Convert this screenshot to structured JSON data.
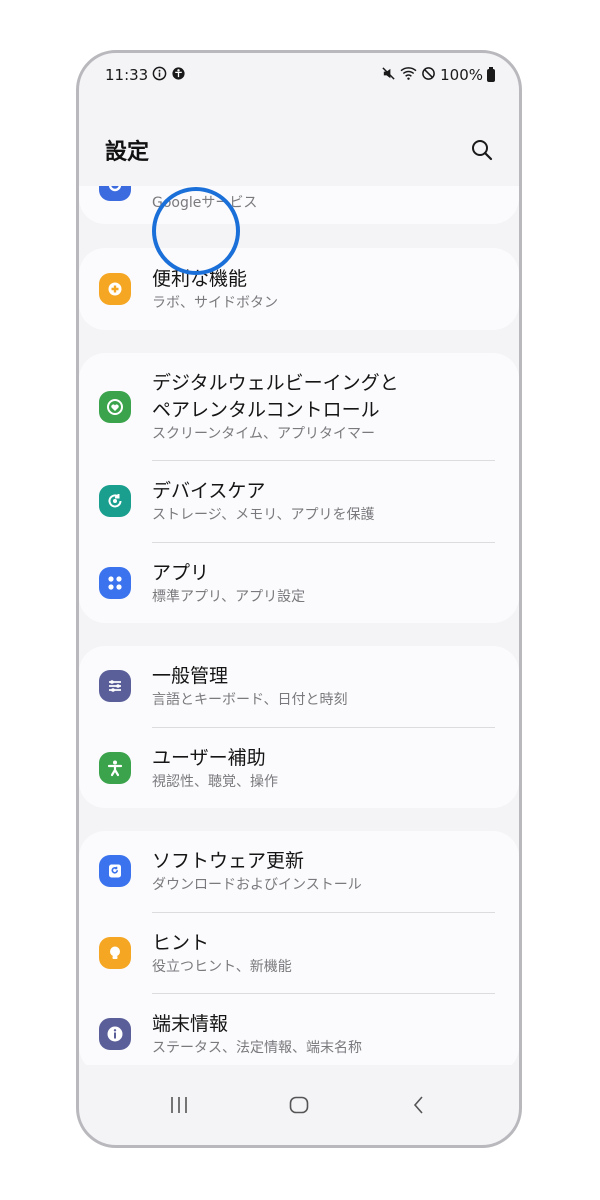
{
  "status_bar": {
    "time": "11:33",
    "left_icons": [
      "info-icon",
      "accessibility-icon"
    ],
    "right_icons": [
      "mute-icon",
      "wifi-icon",
      "dnd-icon"
    ],
    "battery": "100%"
  },
  "header": {
    "title": "設定",
    "search_icon": "search-icon"
  },
  "sections": [
    {
      "items": [
        {
          "title": "",
          "subtitle": "Googleサービス",
          "icon": "google-icon",
          "color": "#3c6be0"
        }
      ]
    },
    {
      "items": [
        {
          "title": "便利な機能",
          "subtitle": "ラボ、サイドボタン",
          "icon": "plus-gear-icon",
          "color": "#f5a623"
        }
      ]
    },
    {
      "items": [
        {
          "title": "デジタルウェルビーイングと",
          "title2": "ペアレンタルコントロール",
          "subtitle": "スクリーンタイム、アプリタイマー",
          "icon": "heart-circle-icon",
          "color": "#3aa34b"
        },
        {
          "title": "デバイスケア",
          "subtitle": "ストレージ、メモリ、アプリを保護",
          "icon": "refresh-icon",
          "color": "#1a9e8e"
        },
        {
          "title": "アプリ",
          "subtitle": "標準アプリ、アプリ設定",
          "icon": "apps-grid-icon",
          "color": "#3b73ee"
        }
      ]
    },
    {
      "items": [
        {
          "title": "一般管理",
          "subtitle": "言語とキーボード、日付と時刻",
          "icon": "sliders-icon",
          "color": "#5b5f99"
        },
        {
          "title": "ユーザー補助",
          "subtitle": "視認性、聴覚、操作",
          "icon": "accessibility-icon",
          "color": "#3aa34b"
        }
      ]
    },
    {
      "items": [
        {
          "title": "ソフトウェア更新",
          "subtitle": "ダウンロードおよびインストール",
          "icon": "software-update-icon",
          "color": "#3b73ee"
        },
        {
          "title": "ヒント",
          "subtitle": "役立つヒント、新機能",
          "icon": "lightbulb-icon",
          "color": "#f5a623"
        },
        {
          "title": "端末情報",
          "subtitle": "ステータス、法定情報、端末名称",
          "icon": "info-icon",
          "color": "#5b5f99"
        }
      ]
    }
  ],
  "nav_bar": {
    "recents_icon": "recents-icon",
    "home_icon": "home-icon",
    "back_icon": "back-icon"
  }
}
